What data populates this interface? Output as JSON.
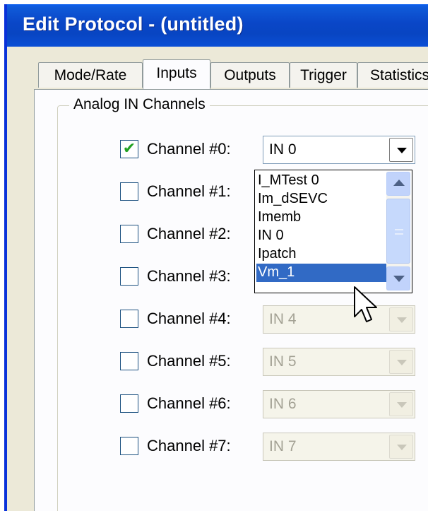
{
  "window": {
    "title": "Edit Protocol - (untitled)"
  },
  "tabs": [
    {
      "label": "Mode/Rate",
      "active": false
    },
    {
      "label": "Inputs",
      "active": true
    },
    {
      "label": "Outputs",
      "active": false
    },
    {
      "label": "Trigger",
      "active": false
    },
    {
      "label": "Statistics",
      "active": false
    }
  ],
  "group": {
    "label": "Analog IN Channels"
  },
  "channels": [
    {
      "label": "Channel #0:",
      "checked": true,
      "value": "IN 0",
      "enabled": true
    },
    {
      "label": "Channel #1:",
      "checked": false,
      "value": "",
      "enabled": true
    },
    {
      "label": "Channel #2:",
      "checked": false,
      "value": "",
      "enabled": true
    },
    {
      "label": "Channel #3:",
      "checked": false,
      "value": "",
      "enabled": true
    },
    {
      "label": "Channel #4:",
      "checked": false,
      "value": "IN 4",
      "enabled": false
    },
    {
      "label": "Channel #5:",
      "checked": false,
      "value": "IN 5",
      "enabled": false
    },
    {
      "label": "Channel #6:",
      "checked": false,
      "value": "IN 6",
      "enabled": false
    },
    {
      "label": "Channel #7:",
      "checked": false,
      "value": "IN 7",
      "enabled": false
    }
  ],
  "dropdown": {
    "items": [
      "I_MTest 0",
      "Im_dSEVC",
      "Imemb",
      "IN 0",
      "Ipatch",
      "Vm_1"
    ],
    "highlighted": "Vm_1"
  },
  "icons": {
    "checkmark": "checkmark-icon",
    "combo_arrow": "chevron-down-icon",
    "scroll_up": "scroll-up-icon",
    "scroll_down": "scroll-down-icon",
    "cursor": "mouse-pointer-icon"
  },
  "colors": {
    "title_bar": "#0a46c7",
    "selection": "#316ac5",
    "checkmark": "#21a121",
    "dialog_bg": "#ece9d8"
  }
}
